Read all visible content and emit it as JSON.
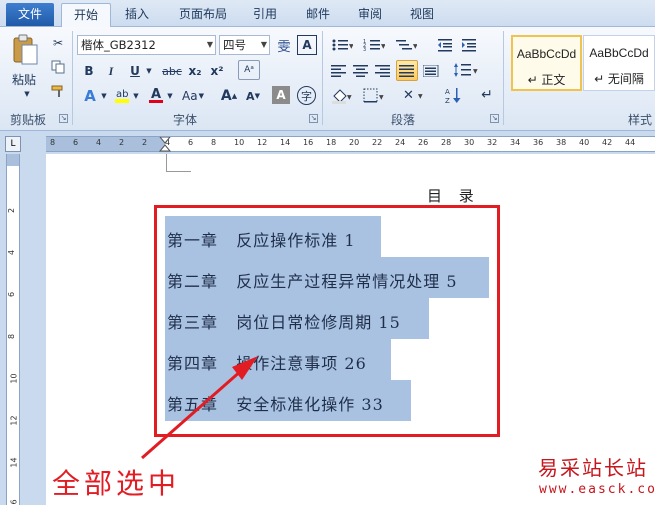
{
  "tabs": {
    "file": "文件",
    "items": [
      {
        "label": "开始",
        "active": true
      },
      {
        "label": "插入",
        "active": false
      },
      {
        "label": "页面布局",
        "active": false
      },
      {
        "label": "引用",
        "active": false
      },
      {
        "label": "邮件",
        "active": false
      },
      {
        "label": "审阅",
        "active": false
      },
      {
        "label": "视图",
        "active": false
      }
    ]
  },
  "ribbon": {
    "clipboard": {
      "paste_label": "粘贴",
      "group_label": "剪贴板"
    },
    "font": {
      "group_label": "字体",
      "font_name": "楷体_GB2312",
      "font_size": "四号",
      "phonetic_glyph": "雯",
      "encircle_glyph": "字",
      "bold": "B",
      "italic": "I",
      "underline": "U",
      "strike": "abc",
      "subscript": "x₂",
      "superscript": "x²",
      "case": "Aa",
      "grow": "A",
      "shrink": "A",
      "clear": "A",
      "font_color": "#e0001b",
      "highlight_color": "#ffff00"
    },
    "paragraph": {
      "group_label": "段落"
    },
    "styles": {
      "group_label": "样式",
      "items": [
        {
          "sample": "AaBbCcDd",
          "name": "↵ 正文",
          "selected": true
        },
        {
          "sample": "AaBbCcDd",
          "name": "↵ 无间隔",
          "selected": false
        }
      ]
    }
  },
  "ruler": {
    "corner": "L",
    "h_numbers": [
      "8",
      "6",
      "4",
      "2",
      "2",
      "4",
      "6",
      "8",
      "10",
      "12",
      "14",
      "16",
      "18",
      "20",
      "22",
      "24",
      "26",
      "28",
      "30",
      "32",
      "34",
      "36",
      "38",
      "40",
      "42",
      "44"
    ],
    "v_numbers": [
      "2",
      "4",
      "6",
      "8",
      "10",
      "12",
      "14",
      "16"
    ]
  },
  "document": {
    "title": "目 录",
    "toc": [
      {
        "chapter": "第一章",
        "title": "反应操作标准",
        "page": "1"
      },
      {
        "chapter": "第二章",
        "title": "反应生产过程异常情况处理",
        "page": "5"
      },
      {
        "chapter": "第三章",
        "title": "岗位日常检修周期",
        "page": "15"
      },
      {
        "chapter": "第四章",
        "title": "操作注意事项",
        "page": "26"
      },
      {
        "chapter": "第五章",
        "title": "安全标准化操作",
        "page": "33"
      }
    ]
  },
  "annotation": {
    "text": "全部选中",
    "color": "#e21c23"
  },
  "watermark": {
    "text": "易采站长站",
    "url": "www.easck.com"
  }
}
